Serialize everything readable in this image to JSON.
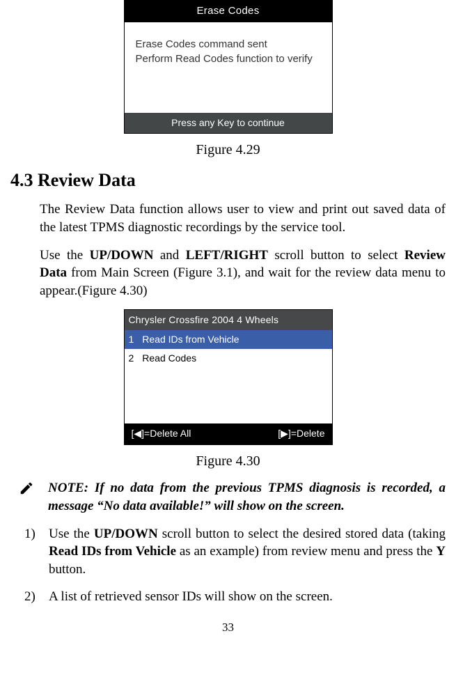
{
  "screen1": {
    "header": "Erase Codes",
    "line1": "Erase Codes command sent",
    "line2": "Perform Read Codes function to verify",
    "footer": "Press any Key to continue"
  },
  "fig1_caption": "Figure 4.29",
  "section_heading": "4.3 Review Data",
  "para1_a": "The Review Data function allows user to view and print out saved data of the latest TPMS diagnostic recordings by the service tool.",
  "para2_a": "Use the ",
  "para2_b": "UP/DOWN",
  "para2_c": " and ",
  "para2_d": "LEFT/RIGHT",
  "para2_e": " scroll button to select ",
  "para2_f": "Review Data",
  "para2_g": " from Main Screen (Figure 3.1), and wait for the review data menu to appear.(Figure 4.30)",
  "screen2": {
    "header": "Chrysler Crossfire 2004 4 Wheels",
    "row1_num": "1",
    "row1_label": "Read IDs from Vehicle",
    "row2_num": "2",
    "row2_label": "Read Codes",
    "footer_left": "[◀]=Delete All",
    "footer_right": "[▶]=Delete"
  },
  "fig2_caption": "Figure 4.30",
  "note_text": "NOTE: If no data from the previous TPMS diagnosis is recorded, a message “No data available!” will show on the screen.",
  "list1_num": "1)",
  "list1_a": "Use the ",
  "list1_b": "UP/DOWN",
  "list1_c": " scroll button to select the desired stored data (taking ",
  "list1_d": "Read IDs from Vehicle",
  "list1_e": " as an example) from review menu and press the ",
  "list1_f": "Y",
  "list1_g": " button.",
  "list2_num": "2)",
  "list2_a": "A list of retrieved sensor IDs will show on the screen.",
  "page_num": "33"
}
